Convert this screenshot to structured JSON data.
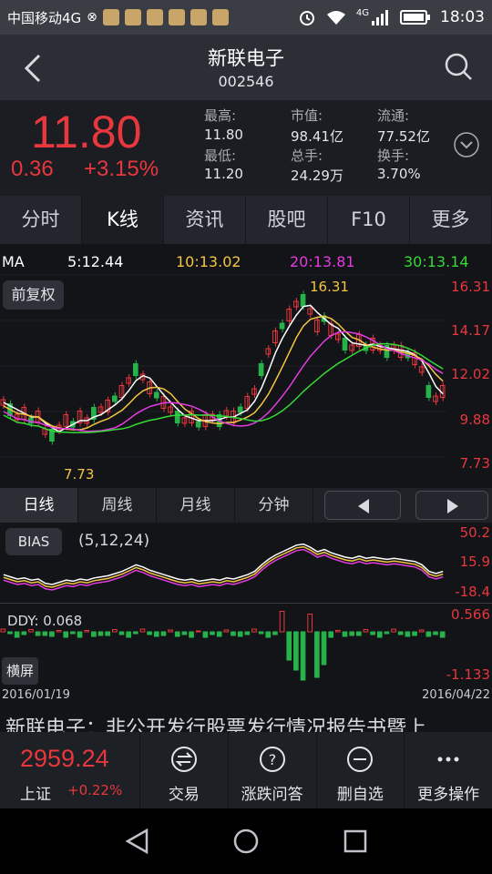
{
  "status_bar": {
    "carrier": "中国移动4G",
    "network": "4G",
    "time": "18:03"
  },
  "header": {
    "title": "新联电子",
    "code": "002546"
  },
  "quote": {
    "price": "11.80",
    "change": "0.36",
    "change_pct": "+3.15%",
    "high_label": "最高:",
    "high": "11.80",
    "low_label": "最低:",
    "low": "11.20",
    "mcap_label": "市值:",
    "mcap": "98.41亿",
    "vol_label": "总手:",
    "vol": "24.29万",
    "float_label": "流通:",
    "float": "77.52亿",
    "turnover_label": "换手:",
    "turnover": "3.70%"
  },
  "tabs": [
    "分时",
    "K线",
    "资讯",
    "股吧",
    "F10",
    "更多"
  ],
  "chart": {
    "ma_label": "MA",
    "ma5": "5:12.44",
    "ma10": "10:13.02",
    "ma20": "20:13.81",
    "ma30": "30:13.14",
    "adjust_button": "前复权",
    "y_ticks": [
      "16.31",
      "14.17",
      "12.02",
      "9.88",
      "7.73"
    ],
    "max_label": "16.31",
    "min_label": "7.73",
    "colors": {
      "up": "#e8373d",
      "down": "#27b34a",
      "ma5": "#ffffff",
      "ma10": "#f5c542",
      "ma20": "#e23be0",
      "ma30": "#36d936"
    }
  },
  "periods": [
    "日线",
    "周线",
    "月线",
    "分钟"
  ],
  "bias": {
    "button": "BIAS",
    "params": "(5,12,24)",
    "ticks": [
      "50.2",
      "15.9",
      "-18.4"
    ]
  },
  "ddy": {
    "label": "DDY: 0.068",
    "ticks": [
      "0.566",
      "-1.133"
    ],
    "landscape_button": "横屏"
  },
  "dates": {
    "start": "2016/01/19",
    "end": "2016/04/22"
  },
  "news_headline": "新联电子：非公开发行股票发行情况报告书暨上",
  "bottom_bar": {
    "index_value": "2959.24",
    "index_name": "上证",
    "index_change": "+0.22%",
    "buttons": [
      {
        "label": "交易",
        "icon": "trade-icon"
      },
      {
        "label": "涨跌问答",
        "icon": "question-icon"
      },
      {
        "label": "删自选",
        "icon": "remove-icon"
      },
      {
        "label": "更多操作",
        "icon": "more-icon"
      }
    ]
  }
}
